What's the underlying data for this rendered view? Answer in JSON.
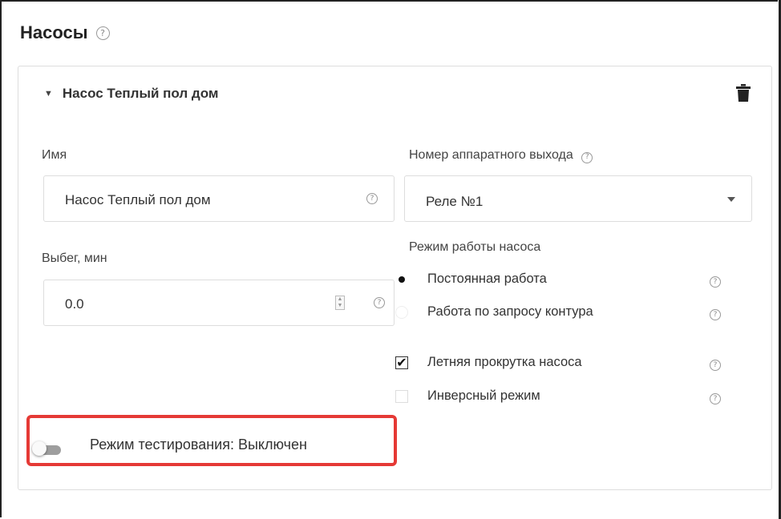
{
  "page": {
    "title": "Насосы",
    "help_glyph": "?"
  },
  "pump": {
    "header_title": "Насос Теплый пол дом",
    "name_label": "Имя",
    "name_value": "Насос Теплый пол дом",
    "output_label": "Номер аппаратного выхода",
    "output_value": "Реле №1",
    "runout_label": "Выбег, мин",
    "runout_value": "0.0",
    "mode_label": "Режим работы насоса",
    "modes": [
      {
        "label": "Постоянная работа",
        "selected": true
      },
      {
        "label": "Работа по запросу контура",
        "selected": false
      }
    ],
    "options": [
      {
        "label": "Летняя прокрутка насоса",
        "checked": true
      },
      {
        "label": "Инверсный режим",
        "checked": false
      }
    ],
    "test_mode_label": "Режим тестирования: Выключен",
    "test_mode_enabled": false
  },
  "icons": {
    "caret": "caret-down-icon",
    "delete": "trash-icon",
    "help": "help-circle-icon",
    "dropdown": "chevron-down-icon"
  },
  "colors": {
    "highlight": "#e53935",
    "toggle_track": "#9e9e9e"
  }
}
